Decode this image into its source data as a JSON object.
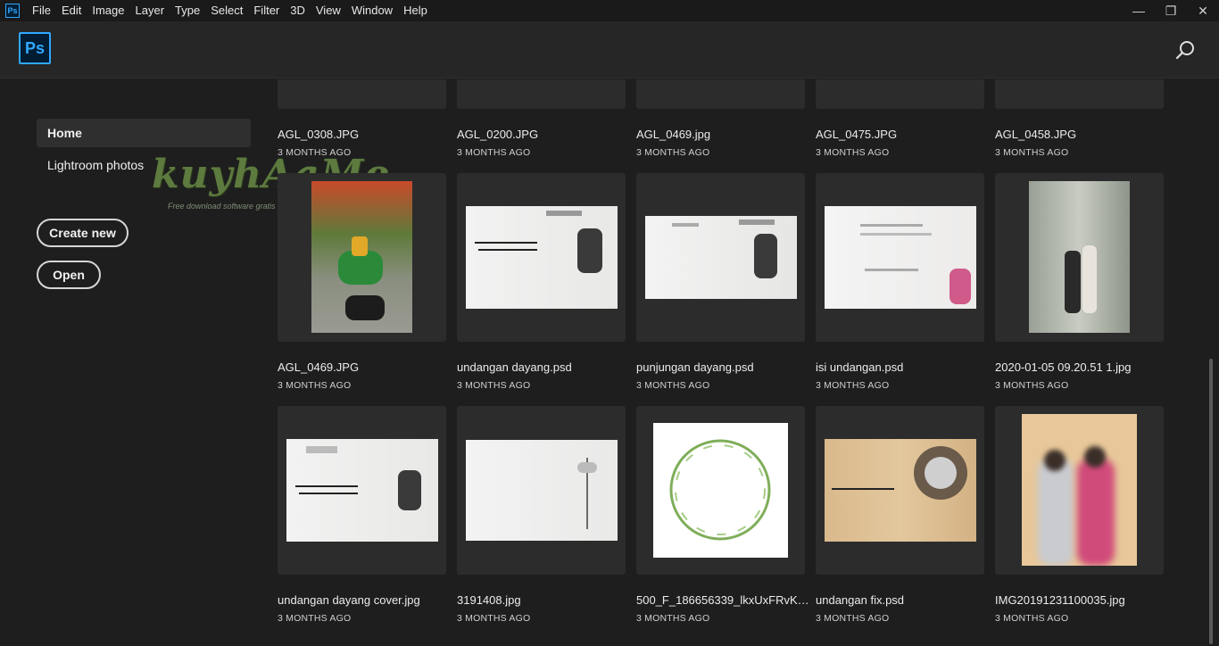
{
  "menubar": {
    "app_icon": "Ps",
    "items": [
      "File",
      "Edit",
      "Image",
      "Layer",
      "Type",
      "Select",
      "Filter",
      "3D",
      "View",
      "Window",
      "Help"
    ],
    "controls": {
      "minimize": "—",
      "restore": "❐",
      "close": "✕"
    }
  },
  "header": {
    "logo": "Ps",
    "search_icon": "search-icon"
  },
  "sidebar": {
    "nav": [
      {
        "label": "Home",
        "active": true
      },
      {
        "label": "Lightroom photos",
        "active": false
      }
    ],
    "create_new": "Create new",
    "open": "Open",
    "watermark": "kuyhAaMe",
    "watermark_sub": "Free download software gratis"
  },
  "files": {
    "row0": [
      {
        "name": "AGL_0308.JPG",
        "date": "3 MONTHS AGO"
      },
      {
        "name": "AGL_0200.JPG",
        "date": "3 MONTHS AGO"
      },
      {
        "name": "AGL_0469.jpg",
        "date": "3 MONTHS AGO"
      },
      {
        "name": "AGL_0475.JPG",
        "date": "3 MONTHS AGO"
      },
      {
        "name": "AGL_0458.JPG",
        "date": "3 MONTHS AGO"
      }
    ],
    "row1": [
      {
        "name": "AGL_0469.JPG",
        "date": "3 MONTHS AGO"
      },
      {
        "name": "undangan dayang.psd",
        "date": "3 MONTHS AGO"
      },
      {
        "name": "punjungan dayang.psd",
        "date": "3 MONTHS AGO"
      },
      {
        "name": "isi undangan.psd",
        "date": "3 MONTHS AGO"
      },
      {
        "name": "2020-01-05 09.20.51 1.jpg",
        "date": "3 MONTHS AGO"
      }
    ],
    "row2": [
      {
        "name": "undangan dayang cover.jpg",
        "date": "3 MONTHS AGO"
      },
      {
        "name": "3191408.jpg",
        "date": "3 MONTHS AGO"
      },
      {
        "name": "500_F_186656339_lkxUxFRvK2...",
        "date": "3 MONTHS AGO"
      },
      {
        "name": "undangan fix.psd",
        "date": "3 MONTHS AGO"
      },
      {
        "name": "IMG20191231100035.jpg",
        "date": "3 MONTHS AGO"
      }
    ]
  },
  "colors": {
    "accent": "#31a8ff",
    "background": "#1e1e1e",
    "card": "#2c2c2c"
  }
}
